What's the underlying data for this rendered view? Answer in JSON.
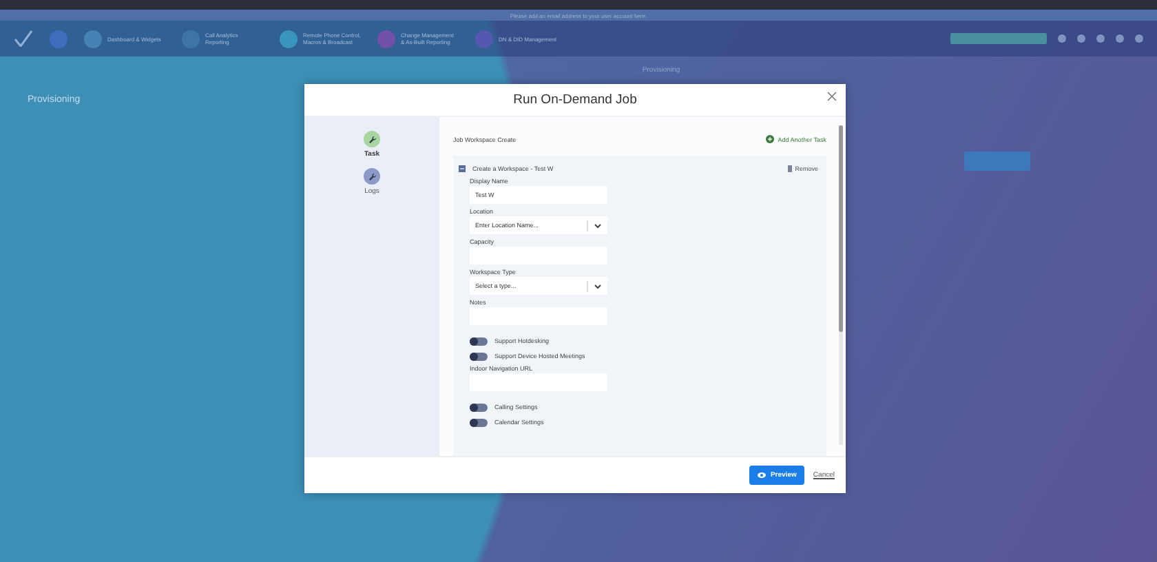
{
  "background": {
    "banner": "Please add an email address to your user account here.",
    "nav_items": [
      {
        "label": "Dashboard & Widgets",
        "color": "#4a86b8"
      },
      {
        "label": "Call Analytics Reporting",
        "color": "#3f78a8"
      },
      {
        "label": "Remote Phone Control, Macros & Broadcast",
        "color": "#3a9cc0"
      },
      {
        "label": "Change Management & As-Built Reporting",
        "color": "#7a4fa8"
      },
      {
        "label": "DN & DID Management",
        "color": "#5a58b0"
      }
    ],
    "breadcrumb_tab": "Provisioning",
    "page_title": "Provisioning"
  },
  "modal": {
    "title": "Run On-Demand Job",
    "steps": [
      {
        "label": "Task",
        "selected": true
      },
      {
        "label": "Logs",
        "selected": false
      }
    ],
    "job_name": "Job Workspace Create",
    "add_task": "Add Another Task",
    "task": {
      "title": "Create a Workspace - Test W",
      "remove": "Remove",
      "fields": [
        {
          "kind": "text",
          "label": "Display Name",
          "value": "Test W"
        },
        {
          "kind": "select",
          "label": "Location",
          "placeholder": "Enter Location Name..."
        },
        {
          "kind": "text",
          "label": "Capacity"
        },
        {
          "kind": "select",
          "label": "Workspace Type",
          "placeholder": "Select a type..."
        },
        {
          "kind": "text",
          "label": "Notes"
        },
        {
          "kind": "toggle",
          "label": "Support Hotdesking",
          "on": false
        },
        {
          "kind": "toggle",
          "label": "Support Device Hosted Meetings",
          "on": false
        },
        {
          "kind": "text",
          "label": "Indoor Navigation URL"
        },
        {
          "kind": "toggle",
          "label": "Calling Settings",
          "on": false
        },
        {
          "kind": "toggle",
          "label": "Calendar Settings",
          "on": false
        }
      ]
    },
    "preview": "Preview",
    "cancel": "Cancel"
  }
}
